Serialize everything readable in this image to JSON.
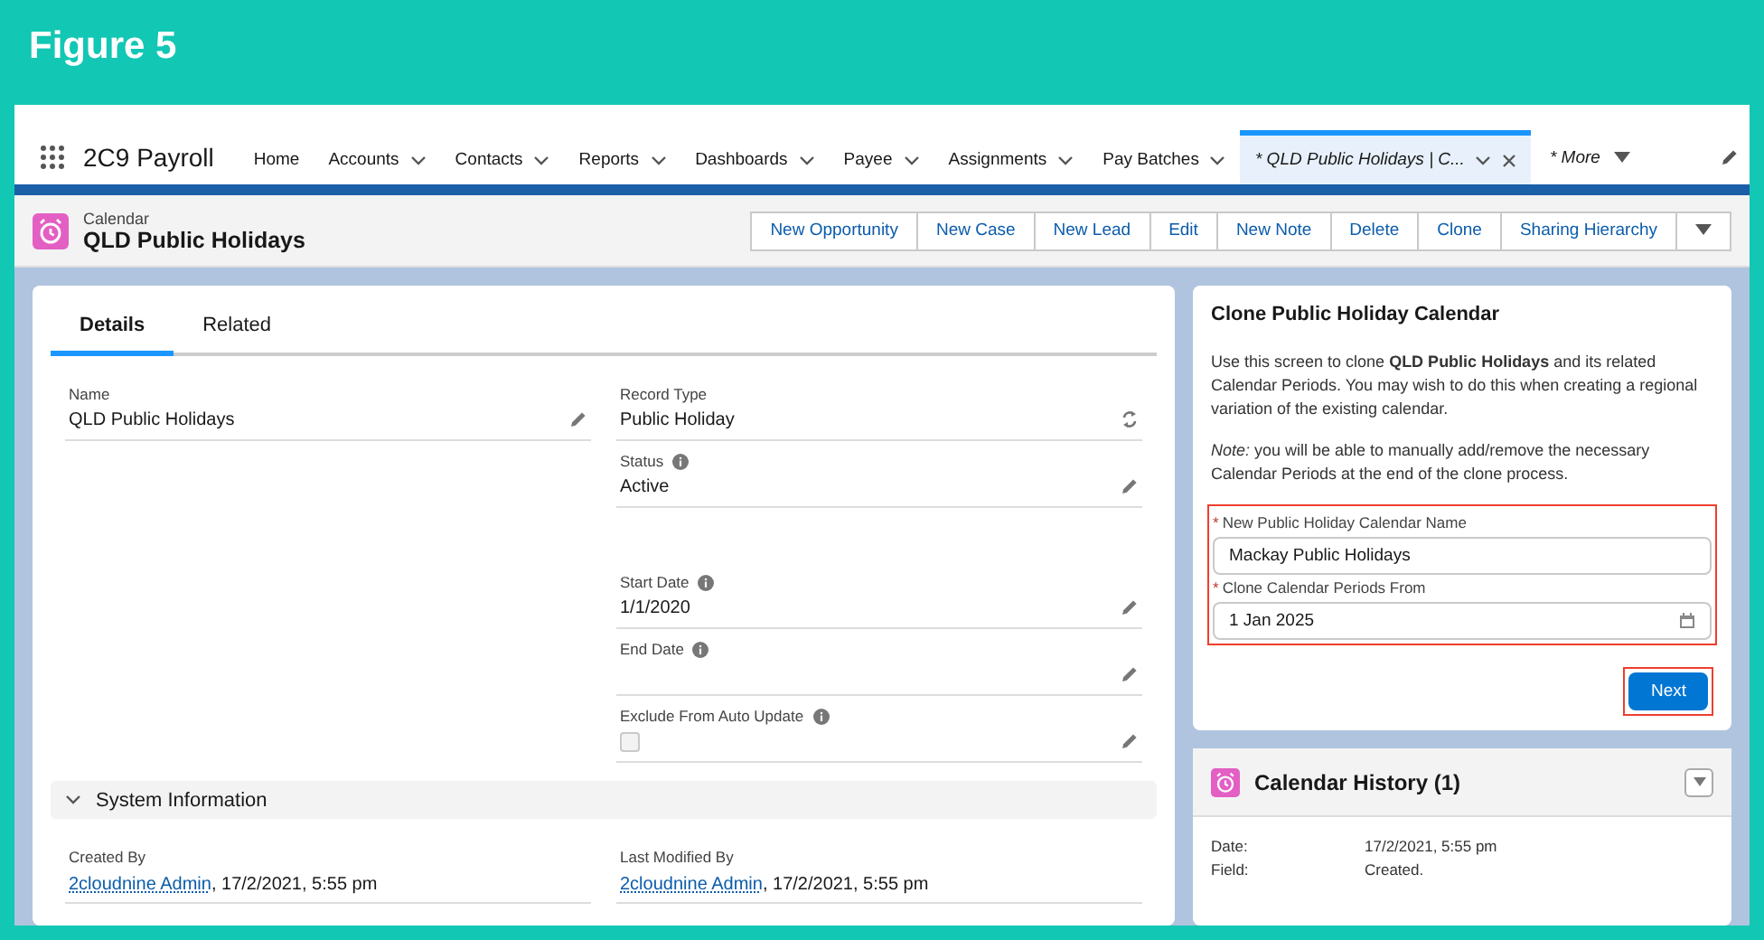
{
  "figure_title": "Figure 5",
  "nav": {
    "app_name": "2C9 Payroll",
    "items": [
      {
        "label": "Home",
        "dropdown": false,
        "selected": false
      },
      {
        "label": "Accounts",
        "dropdown": true,
        "selected": false
      },
      {
        "label": "Contacts",
        "dropdown": true,
        "selected": false
      },
      {
        "label": "Reports",
        "dropdown": true,
        "selected": false
      },
      {
        "label": "Dashboards",
        "dropdown": true,
        "selected": false
      },
      {
        "label": "Payee",
        "dropdown": true,
        "selected": false
      },
      {
        "label": "Assignments",
        "dropdown": true,
        "selected": false
      },
      {
        "label": "Pay Batches",
        "dropdown": true,
        "selected": false
      },
      {
        "label": "* QLD Public Holidays | C...",
        "dropdown": true,
        "closable": true,
        "selected": true
      }
    ],
    "more": "* More"
  },
  "record": {
    "object": "Calendar",
    "title": "QLD Public Holidays",
    "actions": [
      "New Opportunity",
      "New Case",
      "New Lead",
      "Edit",
      "New Note",
      "Delete",
      "Clone",
      "Sharing Hierarchy"
    ]
  },
  "tabs": [
    {
      "label": "Details",
      "selected": true
    },
    {
      "label": "Related",
      "selected": false
    }
  ],
  "fields_left": [
    {
      "kind": "text",
      "label": "Name",
      "value": "QLD Public Holidays",
      "info": false
    }
  ],
  "fields_right": [
    {
      "kind": "record_type",
      "label": "Record Type",
      "value": "Public Holiday",
      "info": false
    },
    {
      "kind": "text",
      "label": "Status",
      "value": "Active",
      "info": true
    },
    {
      "kind": "text",
      "label": "Start Date",
      "value": "1/1/2020",
      "info": true
    },
    {
      "kind": "text",
      "label": "End Date",
      "info": true
    },
    {
      "kind": "checkbox",
      "label": "Exclude From Auto Update",
      "checked": false,
      "info": true
    }
  ],
  "system_section": {
    "title": "System Information",
    "expanded": true,
    "fields": [
      {
        "label": "Created By",
        "link": "2cloudnine Admin",
        "rest": ", 17/2/2021, 5:55 pm"
      },
      {
        "label": "Last Modified By",
        "link": "2cloudnine Admin",
        "rest": ", 17/2/2021, 5:55 pm"
      }
    ]
  },
  "clone_panel": {
    "title": "Clone Public Holiday Calendar",
    "intro": "Use this screen to clone **QLD Public Holidays** and its related Calendar Periods. You may wish to do this when creating a regional variation of the existing calendar.",
    "note": "*Note:* you will be able to manually add/remove the necessary Calendar Periods at the end of the clone process.",
    "highlighted": true,
    "fields": [
      {
        "kind": "text",
        "required_mark": "*",
        "label": "New Public Holiday Calendar Name",
        "value": "Mackay Public Holidays"
      },
      {
        "kind": "date",
        "required_mark": "*",
        "label": "Clone Calendar Periods From",
        "value": "1 Jan 2025"
      }
    ],
    "button": {
      "label": "Next",
      "highlighted": true
    }
  },
  "history": {
    "title": "Calendar History (1)",
    "rows": [
      {
        "label": "Date:",
        "value": "17/2/2021, 5:55 pm"
      },
      {
        "label": "Field:",
        "value": "Created."
      }
    ]
  }
}
